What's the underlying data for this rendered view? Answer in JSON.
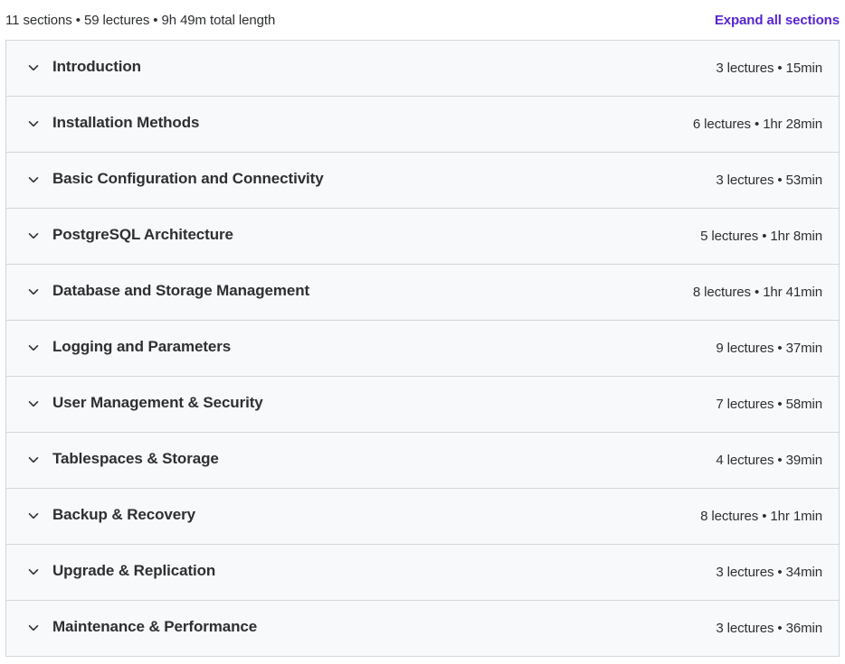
{
  "summary": {
    "text": "11 sections • 59 lectures • 9h 49m total length",
    "expand_label": "Expand all sections"
  },
  "colors": {
    "accent": "#5624d0",
    "row_bg": "#f7f9fa",
    "border": "#d1d7dc",
    "text": "#2d2f31"
  },
  "sections": [
    {
      "title": "Introduction",
      "meta": "3 lectures • 15min",
      "icon": "chevron-down-icon"
    },
    {
      "title": "Installation Methods",
      "meta": "6 lectures • 1hr 28min",
      "icon": "chevron-down-icon"
    },
    {
      "title": "Basic Configuration and Connectivity",
      "meta": "3 lectures • 53min",
      "icon": "chevron-down-icon"
    },
    {
      "title": "PostgreSQL Architecture",
      "meta": "5 lectures • 1hr 8min",
      "icon": "chevron-down-icon"
    },
    {
      "title": "Database and Storage Management",
      "meta": "8 lectures • 1hr 41min",
      "icon": "chevron-down-icon"
    },
    {
      "title": "Logging and Parameters",
      "meta": "9 lectures • 37min",
      "icon": "chevron-down-icon"
    },
    {
      "title": "User Management & Security",
      "meta": "7 lectures • 58min",
      "icon": "chevron-down-icon"
    },
    {
      "title": "Tablespaces & Storage",
      "meta": "4 lectures • 39min",
      "icon": "chevron-down-icon"
    },
    {
      "title": "Backup & Recovery",
      "meta": "8 lectures • 1hr 1min",
      "icon": "chevron-down-icon"
    },
    {
      "title": "Upgrade & Replication",
      "meta": "3 lectures • 34min",
      "icon": "chevron-down-icon"
    },
    {
      "title": "Maintenance & Performance",
      "meta": "3 lectures • 36min",
      "icon": "chevron-down-icon"
    }
  ]
}
